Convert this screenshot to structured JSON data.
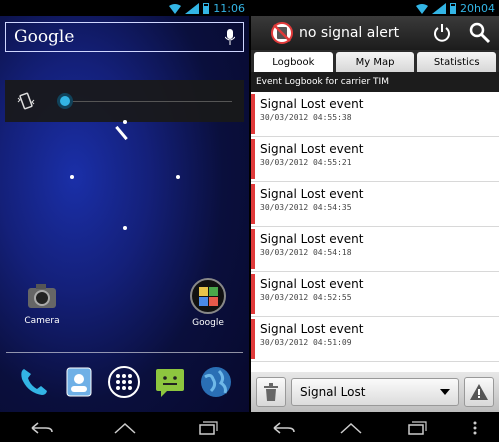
{
  "left": {
    "status": {
      "time": "11:06"
    },
    "search": {
      "label": "Google"
    },
    "apps": [
      {
        "label": "Camera",
        "icon": "camera-icon"
      },
      {
        "label": "Google",
        "icon": "google-folder-icon"
      }
    ],
    "dock": [
      "phone-icon",
      "contacts-icon",
      "app-drawer-icon",
      "messaging-icon",
      "browser-icon"
    ],
    "navbar": [
      "back-icon",
      "home-icon",
      "recent-apps-icon"
    ]
  },
  "right": {
    "status": {
      "time": "20h04"
    },
    "app_title": "no signal alert",
    "tabs": [
      {
        "label": "Logbook",
        "active": true
      },
      {
        "label": "My Map",
        "active": false
      },
      {
        "label": "Statistics",
        "active": false
      }
    ],
    "subheader": "Event Logbook for carrier TIM",
    "events": [
      {
        "title": "Signal Lost event",
        "date": "30/03/2012 04:55:38"
      },
      {
        "title": "Signal Lost event",
        "date": "30/03/2012 04:55:21"
      },
      {
        "title": "Signal Lost event",
        "date": "30/03/2012 04:54:35"
      },
      {
        "title": "Signal Lost event",
        "date": "30/03/2012 04:54:18"
      },
      {
        "title": "Signal Lost event",
        "date": "30/03/2012 04:52:55"
      },
      {
        "title": "Signal Lost event",
        "date": "30/03/2012 04:51:09"
      }
    ],
    "filter_value": "Signal Lost",
    "colors": {
      "accent": "#33b5e5",
      "event_bar": "#e03a3a"
    }
  }
}
